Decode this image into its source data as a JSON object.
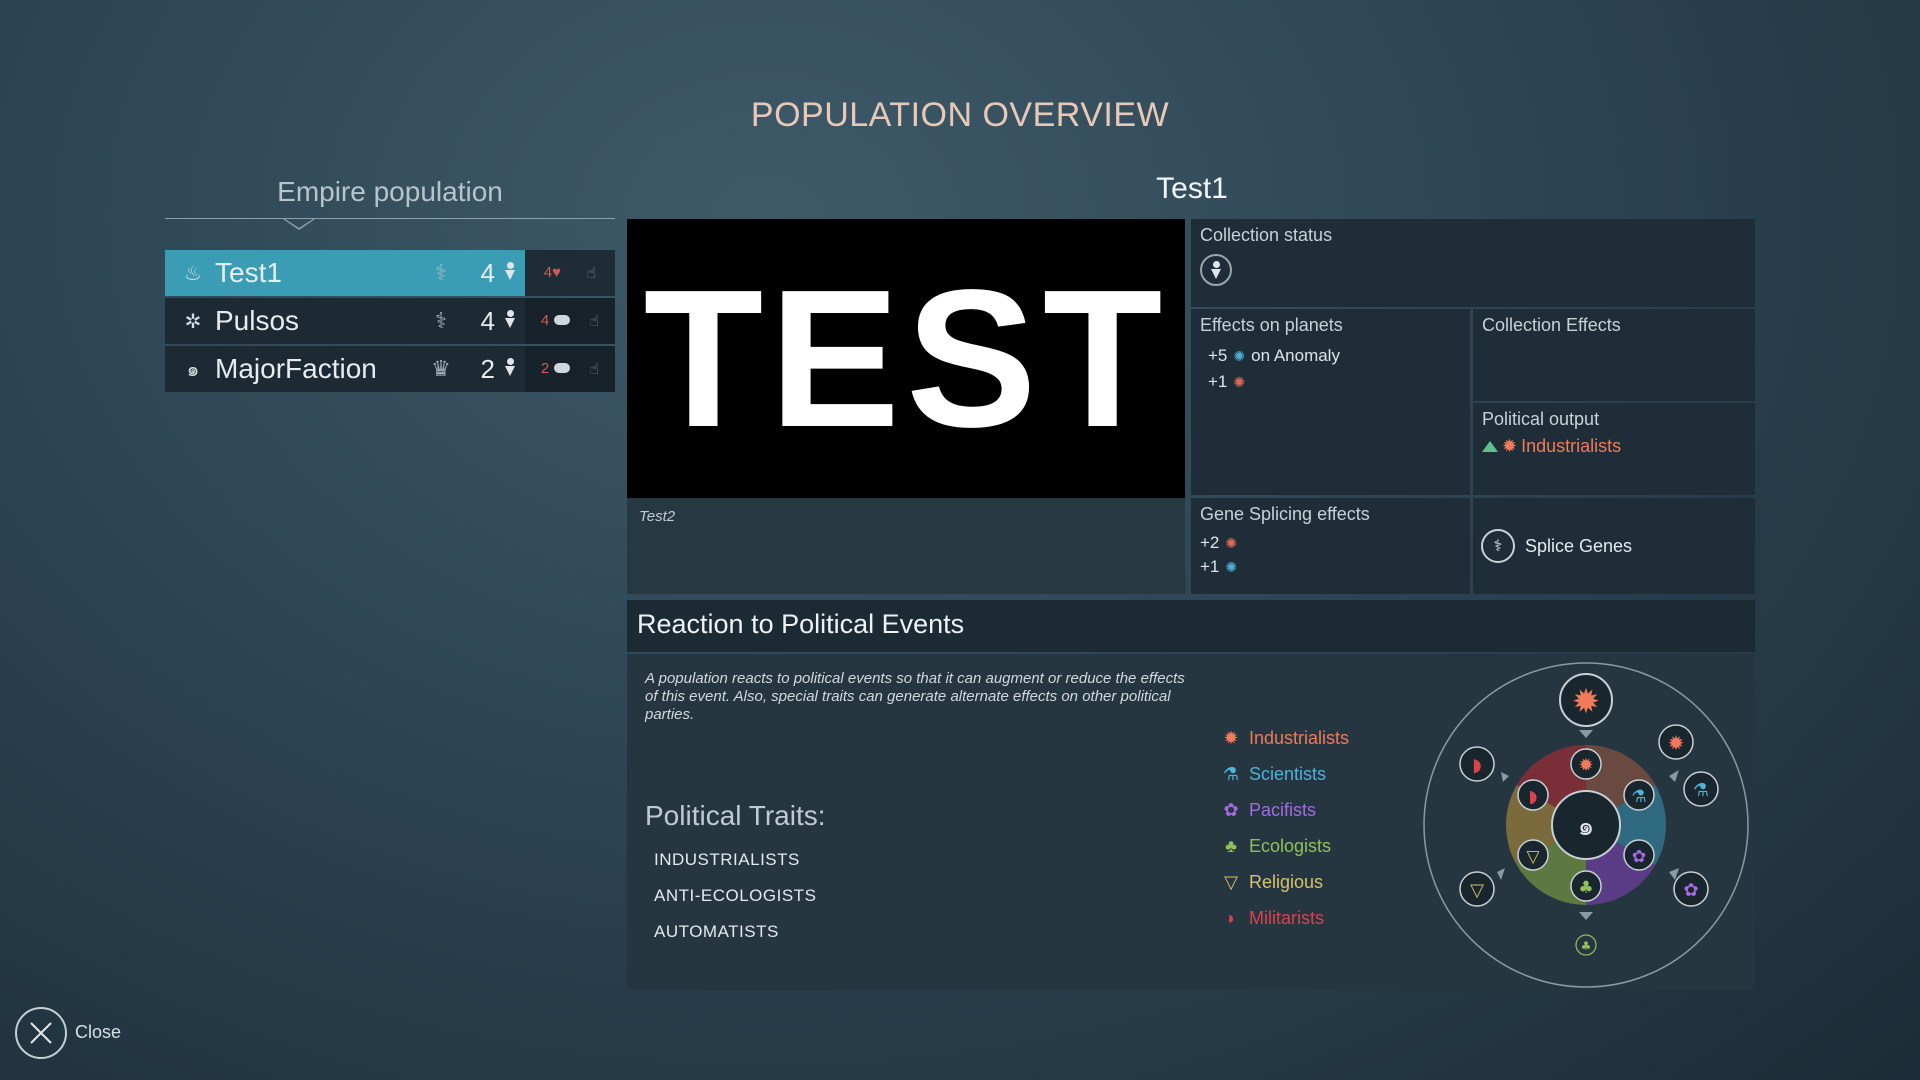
{
  "page": {
    "title": "POPULATION OVERVIEW"
  },
  "empire": {
    "heading": "Empire population",
    "rows": [
      {
        "name": "Test1",
        "count": "4",
        "side_count": "4",
        "selected": true
      },
      {
        "name": "Pulsos",
        "count": "4",
        "side_count": "4",
        "selected": false
      },
      {
        "name": "MajorFaction",
        "count": "2",
        "side_count": "2",
        "selected": false
      }
    ]
  },
  "detail": {
    "title": "Test1",
    "banner_text": "TEST",
    "description": "Test2",
    "collection_status": {
      "title": "Collection status"
    },
    "effects_on_planets": {
      "title": "Effects on planets",
      "lines": [
        {
          "value": "+5",
          "suffix": "on Anomaly"
        },
        {
          "value": "+1",
          "suffix": ""
        }
      ]
    },
    "collection_effects": {
      "title": "Collection Effects"
    },
    "political_output": {
      "title": "Political output",
      "party": "Industrialists"
    },
    "gene_splicing": {
      "title": "Gene Splicing effects",
      "lines": [
        {
          "value": "+2"
        },
        {
          "value": "+1"
        }
      ]
    },
    "splice_button": "Splice Genes"
  },
  "reaction": {
    "title": "Reaction to Political Events",
    "description": "A population reacts to political events so that it can augment or reduce the effects of this event. Also, special traits can generate alternate effects on other political parties.",
    "traits_heading": "Political Traits:",
    "traits": [
      "INDUSTRIALISTS",
      "ANTI-ECOLOGISTS",
      "AUTOMATISTS"
    ],
    "legend": [
      {
        "label": "Industrialists",
        "color": "#f07a5a",
        "icon": "gear-icon"
      },
      {
        "label": "Scientists",
        "color": "#4fb1d9",
        "icon": "flask-icon"
      },
      {
        "label": "Pacifists",
        "color": "#a46ae0",
        "icon": "flower-icon"
      },
      {
        "label": "Ecologists",
        "color": "#8fc05a",
        "icon": "tree-icon"
      },
      {
        "label": "Religious",
        "color": "#d9c06a",
        "icon": "triangle-icon"
      },
      {
        "label": "Militarists",
        "color": "#d9434f",
        "icon": "helmet-icon"
      }
    ]
  },
  "close": {
    "label": "Close"
  }
}
